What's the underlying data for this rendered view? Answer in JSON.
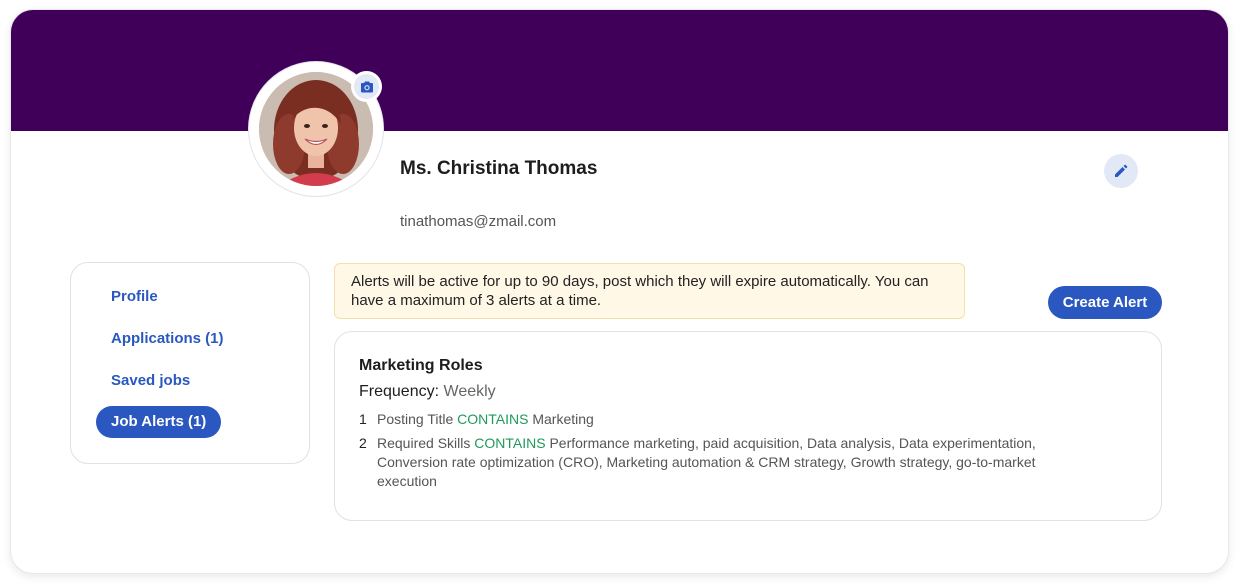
{
  "profile": {
    "name": "Ms. Christina Thomas",
    "email": "tinathomas@zmail.com",
    "camera_icon": "camera-icon",
    "edit_icon": "pencil-icon",
    "banner_color": "#40005a"
  },
  "sidebar": {
    "items": [
      {
        "label": "Profile",
        "active": false
      },
      {
        "label": "Applications (1)",
        "active": false
      },
      {
        "label": "Saved jobs",
        "active": false
      },
      {
        "label": "Job Alerts (1)",
        "active": true
      }
    ]
  },
  "notice": {
    "text": "Alerts will be active for up to 90 days, post which they will expire automatically. You can have a maximum of 3 alerts at a time."
  },
  "actions": {
    "create_alert": "Create Alert"
  },
  "alert": {
    "title": "Marketing Roles",
    "frequency_label": "Frequency:",
    "frequency_value": "Weekly",
    "criteria": [
      {
        "num": "1",
        "field": "Posting Title",
        "operator": "CONTAINS",
        "value": "Marketing"
      },
      {
        "num": "2",
        "field": "Required Skills",
        "operator": "CONTAINS",
        "value": "Performance marketing, paid acquisition, Data analysis, Data experimentation, Conversion rate optimization (CRO), Marketing automation & CRM strategy, Growth strategy, go-to-market execution"
      }
    ]
  },
  "colors": {
    "accent": "#2a58c0",
    "keyword": "#1f9a5b",
    "notice_bg": "#fff8e6"
  }
}
